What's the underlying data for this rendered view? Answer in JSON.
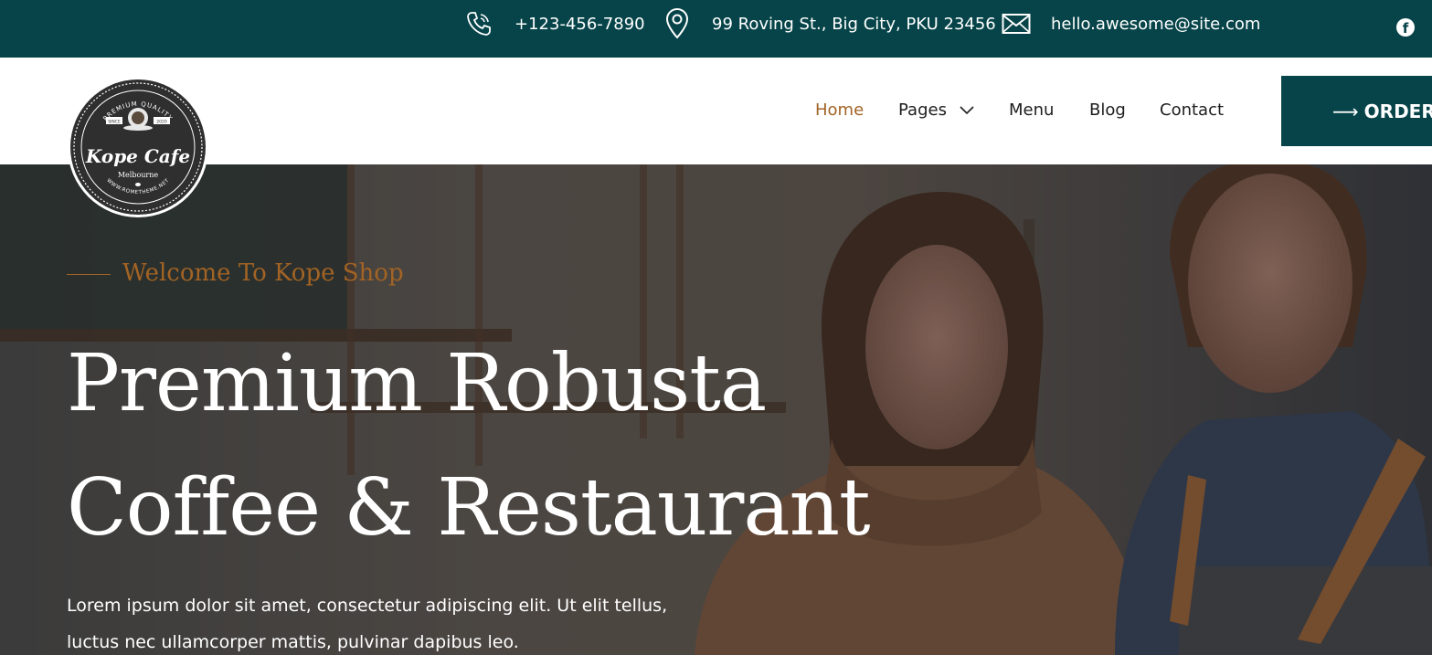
{
  "topbar": {
    "phone": "+123-456-7890",
    "address": "99 Roving St., Big City, PKU 23456",
    "email": "hello.awesome@site.com",
    "social_icon": "facebook-icon",
    "fb_letter": "f"
  },
  "logo": {
    "top_text": "PREMIUM QUALITY",
    "since": "SINCE",
    "year": "2020",
    "name": "Kope Cafe",
    "city": "Melbourne",
    "url": "WWW.ROMETHEME.NET"
  },
  "nav": {
    "items": [
      {
        "label": "Home",
        "active": true
      },
      {
        "label": "Pages",
        "has_dropdown": true
      },
      {
        "label": "Menu"
      },
      {
        "label": "Blog"
      },
      {
        "label": "Contact"
      }
    ],
    "order_label": "ORDER O",
    "order_arrow": "⟶"
  },
  "hero": {
    "welcome": "Welcome To Kope Shop",
    "title_line1": "Premium Robusta",
    "title_line2": "Coffee & Restaurant",
    "desc_line1": "Lorem ipsum dolor sit amet, consectetur adipiscing elit. Ut elit tellus,",
    "desc_line2": "luctus nec ullamcorper mattis, pulvinar dapibus leo."
  },
  "colors": {
    "brand_teal": "#064449",
    "accent_brown": "#a26324"
  }
}
